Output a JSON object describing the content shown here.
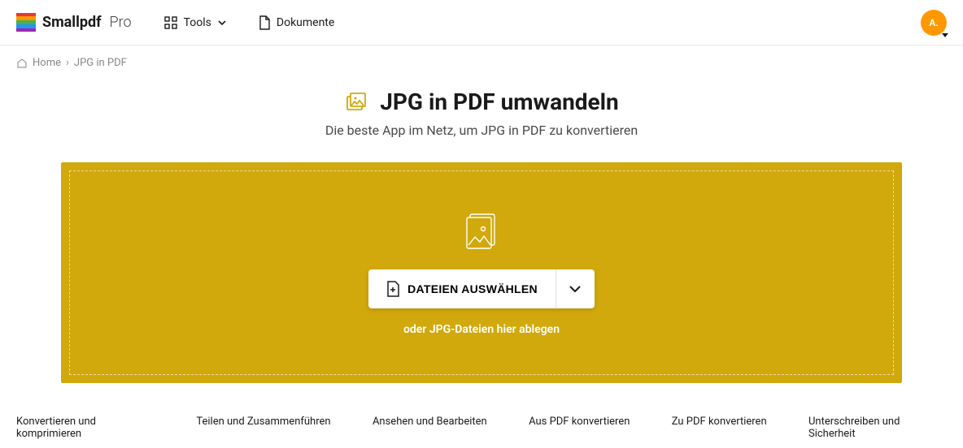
{
  "brand": {
    "name": "Smallpdf",
    "tier": "Pro"
  },
  "nav": {
    "tools": "Tools",
    "documents": "Dokumente"
  },
  "avatar": {
    "initials": "A."
  },
  "breadcrumb": {
    "home": "Home",
    "current": "JPG in PDF"
  },
  "hero": {
    "title": "JPG in PDF umwandeln",
    "subtitle": "Die beste App im Netz, um JPG in PDF zu konvertieren"
  },
  "dropzone": {
    "button": "DATEIEN AUSWÄHLEN",
    "hint": "oder JPG-Dateien hier ablegen"
  },
  "footer": {
    "col1": "Konvertieren und komprimieren",
    "col2": "Teilen und Zusammenführen",
    "col3": "Ansehen und Bearbeiten",
    "col4": "Aus PDF konvertieren",
    "col5": "Zu PDF konvertieren",
    "col6": "Unterschreiben und Sicherheit"
  },
  "colors": {
    "accent": "#d1a90d",
    "avatar": "#ff9800"
  }
}
